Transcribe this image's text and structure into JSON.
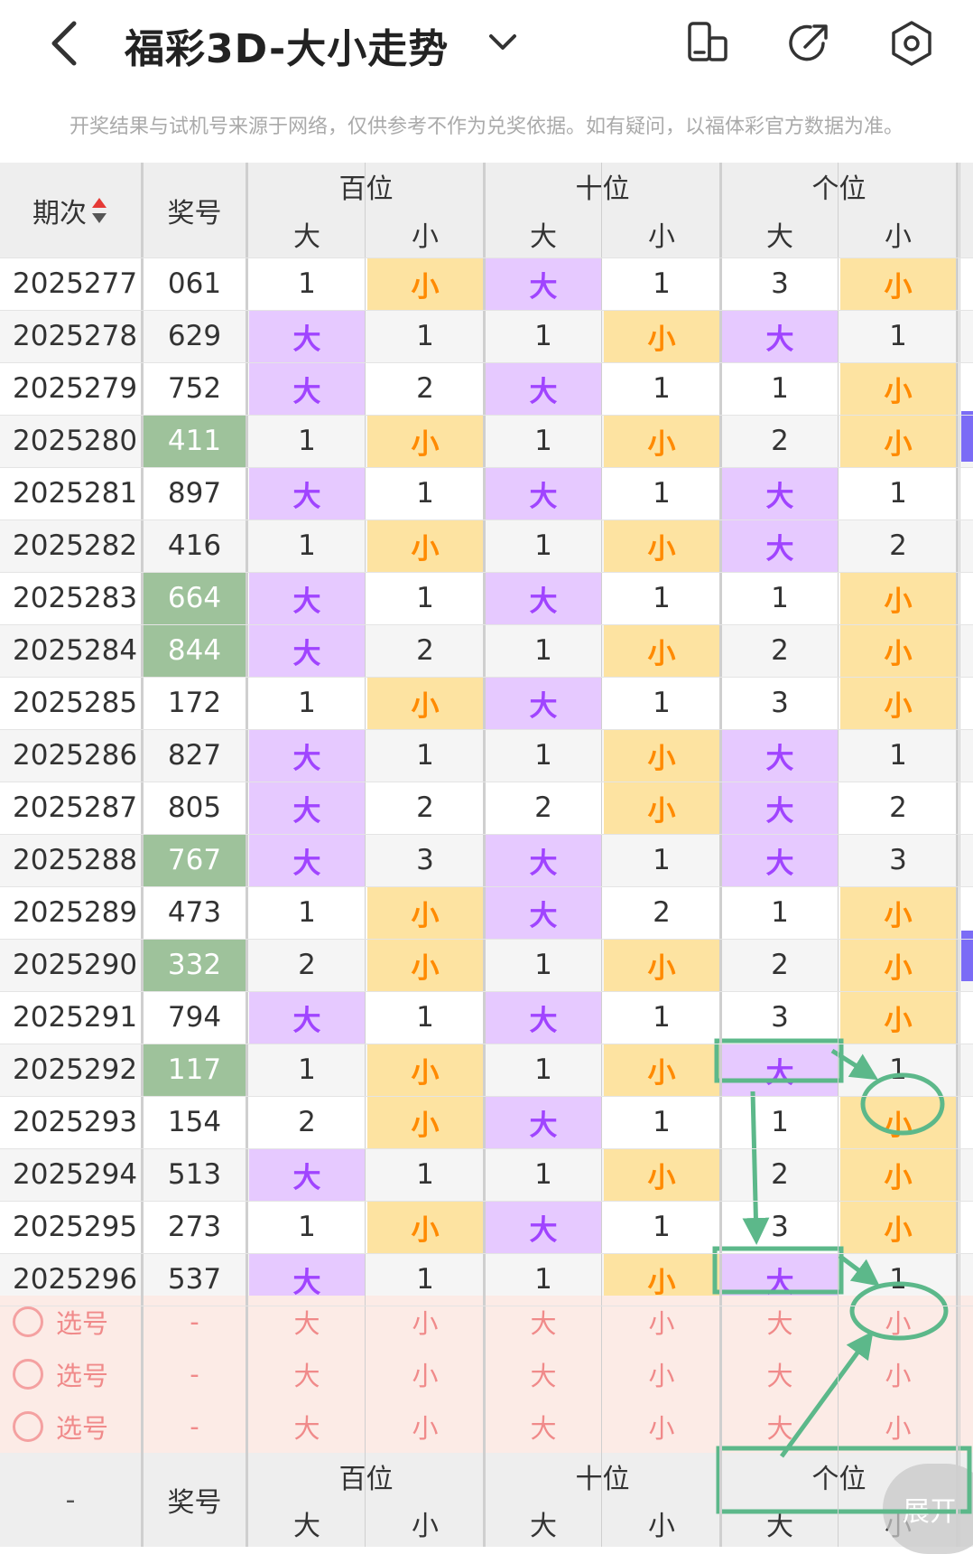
{
  "header": {
    "title": "福彩3D-大小走势",
    "back_icon": "chevron-left-icon",
    "dropdown_icon": "chevron-down-icon",
    "icons": [
      "compare-icon",
      "share-icon",
      "settings-icon"
    ]
  },
  "notice": "开奖结果与试机号来源于网络，仅供参考不作为兑奖依据。如有疑问，以福体彩官方数据为准。",
  "table_header": {
    "issue": "期次",
    "number": "奖号",
    "sort_icon": "sort-icon",
    "groups": [
      "百位",
      "十位",
      "个位"
    ],
    "sub": [
      "大",
      "小"
    ]
  },
  "rows": [
    {
      "issue": "2025277",
      "num": "061",
      "hit": false,
      "cells": [
        "1",
        "小",
        "大",
        "1",
        "3",
        "小"
      ]
    },
    {
      "issue": "2025278",
      "num": "629",
      "hit": false,
      "cells": [
        "大",
        "1",
        "1",
        "小",
        "大",
        "1"
      ]
    },
    {
      "issue": "2025279",
      "num": "752",
      "hit": false,
      "cells": [
        "大",
        "2",
        "大",
        "1",
        "1",
        "小"
      ]
    },
    {
      "issue": "2025280",
      "num": "411",
      "hit": true,
      "cells": [
        "1",
        "小",
        "1",
        "小",
        "2",
        "小"
      ]
    },
    {
      "issue": "2025281",
      "num": "897",
      "hit": false,
      "cells": [
        "大",
        "1",
        "大",
        "1",
        "大",
        "1"
      ]
    },
    {
      "issue": "2025282",
      "num": "416",
      "hit": false,
      "cells": [
        "1",
        "小",
        "1",
        "小",
        "大",
        "2"
      ]
    },
    {
      "issue": "2025283",
      "num": "664",
      "hit": true,
      "cells": [
        "大",
        "1",
        "大",
        "1",
        "1",
        "小"
      ]
    },
    {
      "issue": "2025284",
      "num": "844",
      "hit": true,
      "cells": [
        "大",
        "2",
        "1",
        "小",
        "2",
        "小"
      ]
    },
    {
      "issue": "2025285",
      "num": "172",
      "hit": false,
      "cells": [
        "1",
        "小",
        "大",
        "1",
        "3",
        "小"
      ]
    },
    {
      "issue": "2025286",
      "num": "827",
      "hit": false,
      "cells": [
        "大",
        "1",
        "1",
        "小",
        "大",
        "1"
      ]
    },
    {
      "issue": "2025287",
      "num": "805",
      "hit": false,
      "cells": [
        "大",
        "2",
        "2",
        "小",
        "大",
        "2"
      ]
    },
    {
      "issue": "2025288",
      "num": "767",
      "hit": true,
      "cells": [
        "大",
        "3",
        "大",
        "1",
        "大",
        "3"
      ]
    },
    {
      "issue": "2025289",
      "num": "473",
      "hit": false,
      "cells": [
        "1",
        "小",
        "大",
        "2",
        "1",
        "小"
      ]
    },
    {
      "issue": "2025290",
      "num": "332",
      "hit": true,
      "cells": [
        "2",
        "小",
        "1",
        "小",
        "2",
        "小"
      ]
    },
    {
      "issue": "2025291",
      "num": "794",
      "hit": false,
      "cells": [
        "大",
        "1",
        "大",
        "1",
        "3",
        "小"
      ]
    },
    {
      "issue": "2025292",
      "num": "117",
      "hit": true,
      "cells": [
        "1",
        "小",
        "1",
        "小",
        "大",
        "1"
      ]
    },
    {
      "issue": "2025293",
      "num": "154",
      "hit": false,
      "cells": [
        "2",
        "小",
        "大",
        "1",
        "1",
        "小"
      ]
    },
    {
      "issue": "2025294",
      "num": "513",
      "hit": false,
      "cells": [
        "大",
        "1",
        "1",
        "小",
        "2",
        "小"
      ]
    },
    {
      "issue": "2025295",
      "num": "273",
      "hit": false,
      "cells": [
        "1",
        "小",
        "大",
        "1",
        "3",
        "小"
      ]
    },
    {
      "issue": "2025296",
      "num": "537",
      "hit": false,
      "cells": [
        "大",
        "1",
        "1",
        "小",
        "大",
        "1"
      ]
    }
  ],
  "select_rows": {
    "label": "选号",
    "num": "-",
    "cells": [
      "大",
      "小",
      "大",
      "小",
      "大",
      "小"
    ],
    "count": 3
  },
  "footer": {
    "issue": "-",
    "number": "奖号",
    "groups": [
      "百位",
      "十位",
      "个位"
    ],
    "sub": [
      "大",
      "小"
    ]
  },
  "expand_label": "展开",
  "colors": {
    "big_bg": "#e6c9ff",
    "big_text": "#a044ff",
    "small_bg": "#fde3a1",
    "small_text": "#ff8a00",
    "hit_bg": "#9ec29b",
    "annotation": "#5cb88a",
    "select_bg": "#fcebe6"
  }
}
